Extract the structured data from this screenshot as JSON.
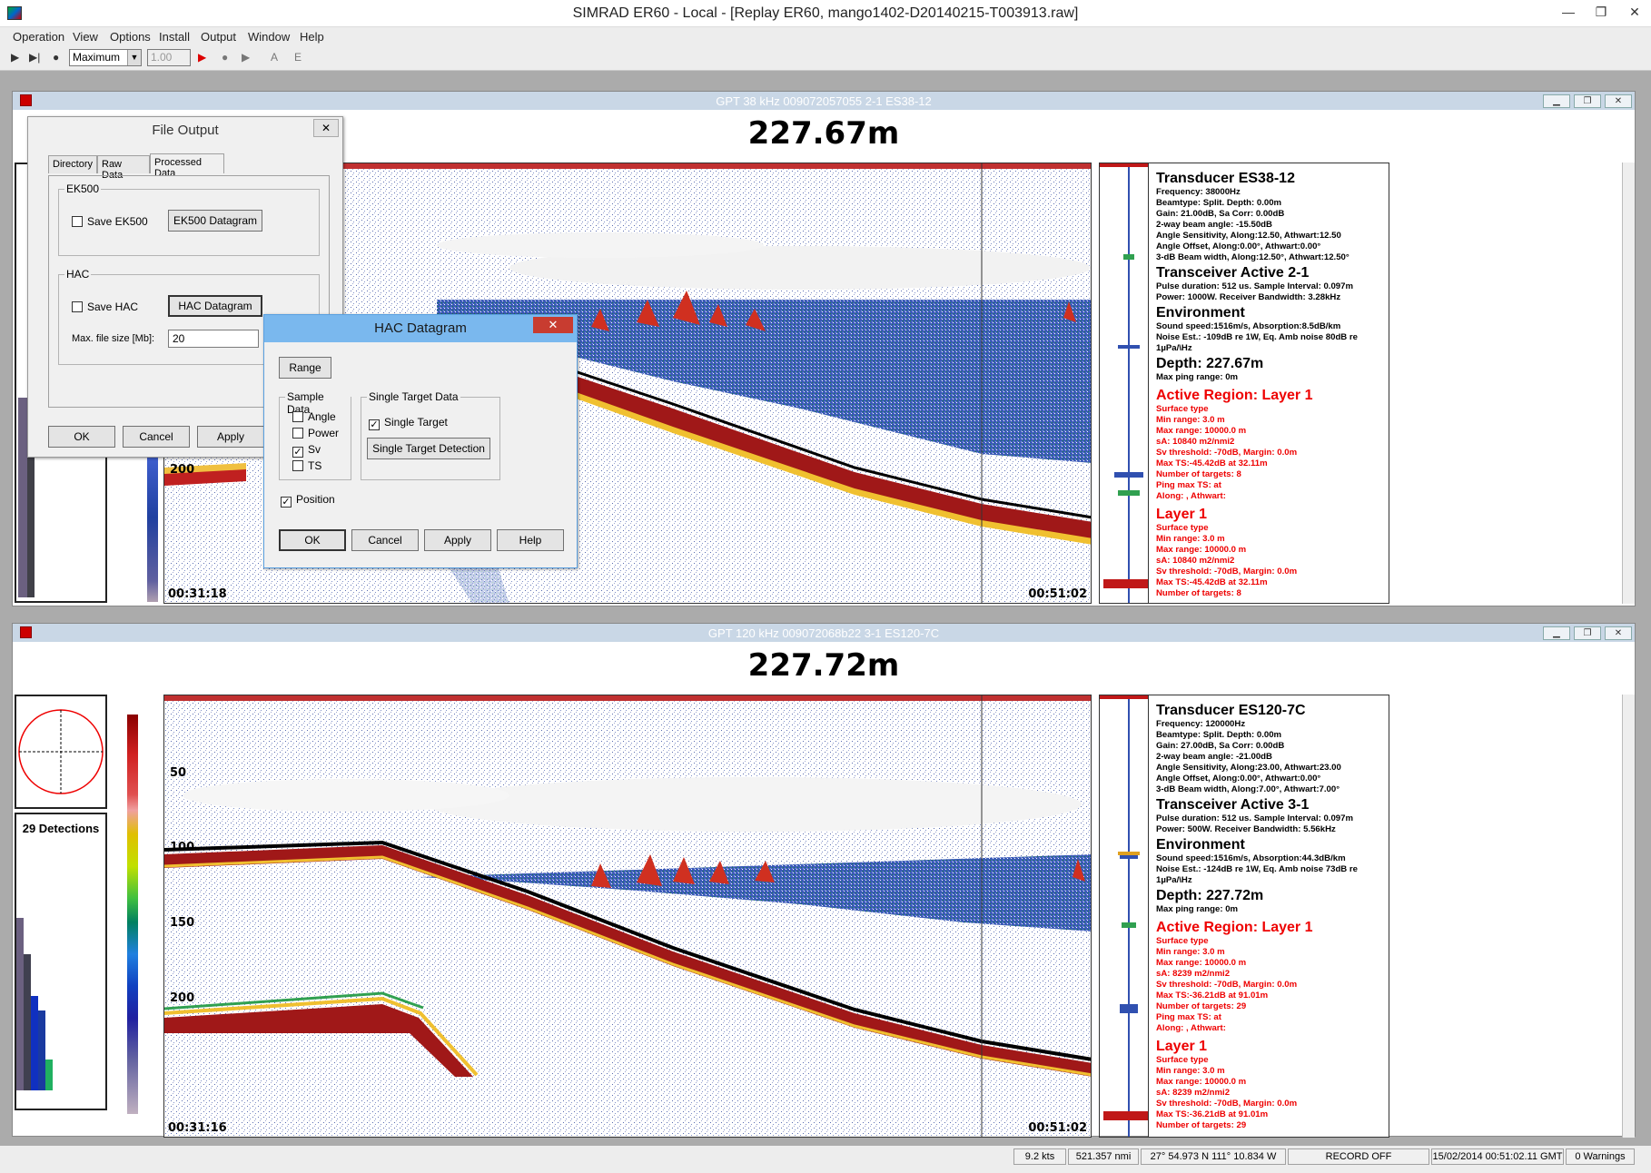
{
  "window": {
    "title": "SIMRAD ER60 - Local - [Replay ER60, mango1402-D20140215-T003913.raw]",
    "minimize": "—",
    "maximize": "❐",
    "close": "✕"
  },
  "menu": [
    "Operation",
    "View",
    "Options",
    "Install",
    "Output",
    "Window",
    "Help"
  ],
  "toolbar": {
    "speed_select": "Maximum",
    "speed_value": "1.00",
    "a_label": "A",
    "e_label": "E"
  },
  "echogram1": {
    "title": "GPT  38 kHz 009072057055 2-1 ES38-12",
    "depth": "227.67m",
    "depth_labels": [
      "200"
    ],
    "start_time": "00:31:18",
    "end_time": "00:51:02",
    "info": {
      "transducer": "Transducer ES38-12",
      "lines1": [
        "Frequency: 38000Hz",
        "Beamtype: Split. Depth: 0.00m",
        "Gain: 21.00dB, Sa Corr: 0.00dB",
        "2-way beam angle: -15.50dB",
        "Angle Sensitivity, Along:12.50, Athwart:12.50",
        "Angle Offset, Along:0.00°, Athwart:0.00°",
        "3-dB Beam width, Along:12.50°, Athwart:12.50°"
      ],
      "transceiver": "Transceiver Active  2-1",
      "lines2": [
        "Pulse duration: 512 us. Sample Interval: 0.097m",
        "Power: 1000W. Receiver Bandwidth: 3.28kHz"
      ],
      "environment": "Environment",
      "lines3": [
        "Sound speed:1516m/s, Absorption:8.5dB/km",
        "Noise Est.: -109dB re 1W, Eq. Amb noise 80dB re 1µPa/\\Hz"
      ],
      "depth_heading": "Depth: 227.67m",
      "max_ping": "Max ping range: 0m",
      "active_region": "Active Region: Layer 1",
      "region_lines": [
        "Surface type",
        "Min range: 3.0 m",
        "Max range: 10000.0 m",
        "sA: 10840 m2/nmi2",
        "Sv threshold: -70dB, Margin: 0.0m",
        "Max TS:-45.42dB at 32.11m",
        "Number of targets:    8",
        "Ping max TS:       at",
        "Along:          , Athwart:"
      ],
      "layer": "Layer 1",
      "layer_lines": [
        "Surface type",
        "Min range: 3.0 m",
        "Max range: 10000.0 m",
        "sA: 10840 m2/nmi2",
        "Sv threshold: -70dB, Margin: 0.0m",
        "Max TS:-45.42dB at 32.11m",
        "Number of targets:    8"
      ]
    }
  },
  "echogram2": {
    "title": "GPT 120 kHz 009072068b22 3-1 ES120-7C",
    "depth": "227.72m",
    "depth_labels": [
      "50",
      "100",
      "150",
      "200"
    ],
    "start_time": "00:31:16",
    "end_time": "00:51:02",
    "detections": "29 Detections",
    "info": {
      "transducer": "Transducer ES120-7C",
      "lines1": [
        "Frequency: 120000Hz",
        "Beamtype: Split. Depth: 0.00m",
        "Gain: 27.00dB, Sa Corr: 0.00dB",
        "2-way beam angle: -21.00dB",
        "Angle Sensitivity, Along:23.00, Athwart:23.00",
        "Angle Offset, Along:0.00°, Athwart:0.00°",
        "3-dB Beam width, Along:7.00°, Athwart:7.00°"
      ],
      "transceiver": "Transceiver Active  3-1",
      "lines2": [
        "Pulse duration: 512 us. Sample Interval: 0.097m",
        "Power: 500W. Receiver Bandwidth: 5.56kHz"
      ],
      "environment": "Environment",
      "lines3": [
        "Sound speed:1516m/s, Absorption:44.3dB/km",
        "Noise Est.: -124dB re 1W, Eq. Amb noise 73dB re 1µPa/\\Hz"
      ],
      "depth_heading": "Depth: 227.72m",
      "max_ping": "Max ping range: 0m",
      "active_region": "Active Region: Layer 1",
      "region_lines": [
        "Surface type",
        "Min range: 3.0 m",
        "Max range: 10000.0 m",
        "sA: 8239 m2/nmi2",
        "Sv threshold: -70dB, Margin: 0.0m",
        "Max TS:-36.21dB at 91.01m",
        "Number of targets:    29",
        "Ping max TS:       at",
        "Along:          , Athwart:"
      ],
      "layer": "Layer 1",
      "layer_lines": [
        "Surface type",
        "Min range: 3.0 m",
        "Max range: 10000.0 m",
        "sA: 8239 m2/nmi2",
        "Sv threshold: -70dB, Margin: 0.0m",
        "Max TS:-36.21dB at 91.01m",
        "Number of targets:    29"
      ]
    }
  },
  "file_output": {
    "title": "File Output",
    "tabs": [
      "Directory",
      "Raw Data",
      "Processed Data"
    ],
    "ek500_group": "EK500",
    "save_ek500": "Save EK500",
    "ek500_button": "EK500 Datagram",
    "hac_group": "HAC",
    "save_hac": "Save HAC",
    "hac_button": "HAC Datagram",
    "max_file_label": "Max. file size [Mb]:",
    "max_file_value": "20",
    "ok": "OK",
    "cancel": "Cancel",
    "apply": "Apply"
  },
  "hac_datagram": {
    "title": "HAC Datagram",
    "range_button": "Range",
    "sample_group": "Sample Data",
    "angle": "Angle",
    "power": "Power",
    "sv": "Sv",
    "ts": "TS",
    "single_group": "Single Target Data",
    "single_target": "Single Target",
    "single_target_detection": "Single Target Detection",
    "position": "Position",
    "ok": "OK",
    "cancel": "Cancel",
    "apply": "Apply",
    "help": "Help"
  },
  "statusbar": {
    "speed": "9.2 kts",
    "distance": "521.357 nmi",
    "position": "27° 54.973 N  111° 10.834 W",
    "record": "RECORD OFF",
    "datetime": "15/02/2014 00:51:02.11 GMT",
    "warnings": "0 Warnings"
  }
}
